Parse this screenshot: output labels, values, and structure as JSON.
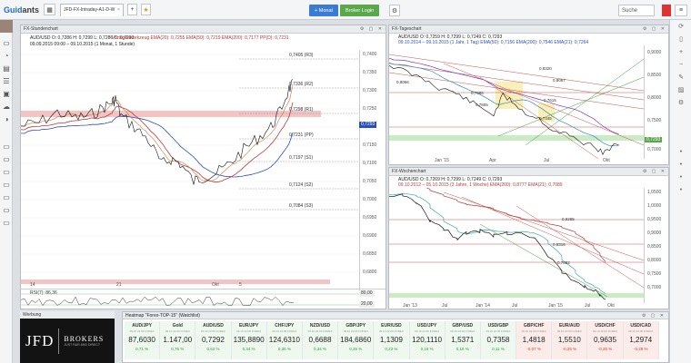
{
  "topbar": {
    "logo_a": "Guid",
    "logo_b": "ants",
    "tab_label": "JFD-FX-Intraday-A1-D-W",
    "tab_close": "×",
    "tab_add": "+",
    "star": "★",
    "btn_monat": "+ Monat",
    "btn_broker": "Broker Login",
    "search": "Suche"
  },
  "colors": {
    "accent": "#3a7bd5",
    "broker_green": "#5aa84a",
    "up": "#2a9a3a",
    "down": "#d23a2a",
    "resistance": "#e8a8a8",
    "support_green": "#b8e4b0"
  },
  "chart_stunde": {
    "title": "FX-Stundenchart",
    "ohlc_line": "AUD/USD  O: 0,7286  H: 0,7299  L: 0,7286  C: 0,7293",
    "ema_line": "Vortageswerkzeug   EMA(20): 0,7255   EMA(50): 0,7219   EMA(200): 0,7177   PP(D): 0,7231",
    "range_line": "09.09.2015 09:00 – 09.10.2015 (1 Monat, 1 Stunde)",
    "y_labels": [
      "0,7400",
      "0,7350",
      "0,7300",
      "0,7250",
      "0,7200",
      "0,7150",
      "0,7100",
      "0,7050",
      "0,7000",
      "0,6950",
      "0,6900",
      "0,6850",
      "0,6800"
    ],
    "price_tag": "0,7293",
    "levels": [
      {
        "label": "0,7405 (R3)"
      },
      {
        "label": "0,7336 (R2)"
      },
      {
        "label": "0,7298 (R1)"
      },
      {
        "label": "0,7231 (PP)"
      },
      {
        "label": "0,7197 (S1)"
      },
      {
        "label": "0,7124 (S2)"
      },
      {
        "label": "0,7084 (S3)"
      }
    ],
    "x_labels": [
      "14",
      "21",
      "Okt",
      "5"
    ],
    "rsi_label": "RSI(7): 86,36",
    "rsi_levels": [
      "80,00",
      "20,00"
    ]
  },
  "chart_tag": {
    "title": "FX-Tageschart",
    "ohlc_line": "AUD/USD  O: 0,7259  H: 0,7299  L: 0,7249  C: 0,7293",
    "ema_line": "09.10.2014 – 09.10.2015 (1 Jahr, 1 Tag)   EMA(50): 0,7156   EMA(200): 0,7546   EMA(21): 0,7264",
    "y_labels": [
      "0,9000",
      "0,8500",
      "0,8000",
      "0,7500",
      "0,7293",
      "0,7000"
    ],
    "fib": [
      "0,8066",
      "0,7986",
      "0,7805",
      "0,8320",
      "0,8067",
      "0,7615",
      "0,7345"
    ],
    "x_labels": [
      "Jan '15",
      "Apr",
      "Jul",
      "Okt"
    ]
  },
  "chart_woche": {
    "title": "FX-Wochenchart",
    "ohlc_line": "AUD/USD  O: 0,7269  H: 0,7299  L: 0,7249  C: 0,7293",
    "ema_line": "09.10.2012 – 05.10.2015 (3 Jahre, 1 Woche)   EMA(200): 0,8777   EMA(21): 0,7089",
    "y_labels": [
      "1,0500",
      "1,0000",
      "0,9500",
      "0,9000",
      "0,8500",
      "0,8000",
      "0,7500",
      "0,7000"
    ],
    "fib": [
      "0,9285",
      "0,8316",
      "0,7882"
    ],
    "x_labels": [
      "Jan '13",
      "Jul",
      "Jan '14",
      "Jul",
      "Jan '15",
      "Jul",
      "Okt"
    ]
  },
  "broker": {
    "header": "Werbung",
    "logo": "JFD",
    "name": "BROKERS",
    "tagline": "JUST FAIR AND DIRECT"
  },
  "watchlist": {
    "title": "Heatmap \"Forex-TOP-15\" (Watchlist)",
    "items": [
      {
        "sym": "AUD/JPY",
        "sub": "09.10 22:00 FOREX",
        "val": "87,6030",
        "chg": "0,71 %",
        "dir": "up"
      },
      {
        "sym": "Gold",
        "sub": "09.10 22:00 FOREX",
        "val": "1.147,00",
        "chg": "0,76 %",
        "dir": "up"
      },
      {
        "sym": "AUD/USD",
        "sub": "09.10 22:00 FOREX",
        "val": "0,7292",
        "chg": "0,52 %",
        "dir": "up"
      },
      {
        "sym": "EUR/JPY",
        "sub": "09.10 22:00 FOREX",
        "val": "135,8890",
        "chg": "0,44 %",
        "dir": "up"
      },
      {
        "sym": "CHF/JPY",
        "sub": "09.10 22:00 FOREX",
        "val": "124,6310",
        "chg": "0,36 %",
        "dir": "up"
      },
      {
        "sym": "NZD/USD",
        "sub": "09.10 22:00 FOREX",
        "val": "0,6688",
        "chg": "0,34 %",
        "dir": "up"
      },
      {
        "sym": "GBP/JPY",
        "sub": "09.10 22:00 FOREX",
        "val": "184,6860",
        "chg": "0,25 %",
        "dir": "up"
      },
      {
        "sym": "EUR/USD",
        "sub": "09.10 22:00 FOREX",
        "val": "1,1309",
        "chg": "0,23 %",
        "dir": "up"
      },
      {
        "sym": "USD/JPY",
        "sub": "09.10 22:00 FOREX",
        "val": "120,1110",
        "chg": "0,18 %",
        "dir": "up"
      },
      {
        "sym": "GBP/USD",
        "sub": "09.10 22:00 FOREX",
        "val": "1,5371",
        "chg": "0,16 %",
        "dir": "up"
      },
      {
        "sym": "USD/GBP",
        "sub": "09.10 22:00 FOREX",
        "val": "0,7358",
        "chg": "0,11 %",
        "dir": "up"
      },
      {
        "sym": "GBP/CHF",
        "sub": "09.10 22:00 FOREX",
        "val": "1,4818",
        "chg": "-0,07 %",
        "dir": "down"
      },
      {
        "sym": "EUR/AUD",
        "sub": "09.10 22:00 FOREX",
        "val": "1,5510",
        "chg": "-0,25 %",
        "dir": "down"
      },
      {
        "sym": "USD/CHF",
        "sub": "09.10 22:00 FOREX",
        "val": "0,9635",
        "chg": "-0,26 %",
        "dir": "down"
      },
      {
        "sym": "USD/CAD",
        "sub": "09.10 22:00 FOREX",
        "val": "1,2974",
        "chg": "-0,28 %",
        "dir": "down"
      }
    ]
  }
}
